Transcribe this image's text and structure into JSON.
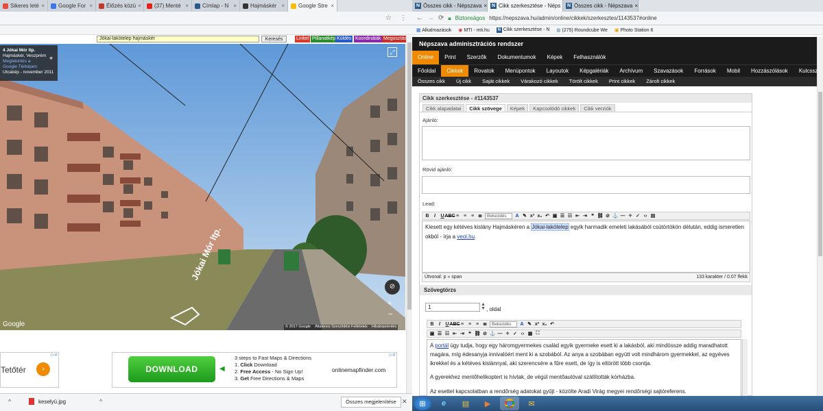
{
  "left": {
    "tabs": [
      {
        "label": "Sikeres leté",
        "color": "#e84b3c"
      },
      {
        "label": "Google For",
        "color": "#3b78e7"
      },
      {
        "label": "Élőzés közü",
        "color": "#c0392b"
      },
      {
        "label": "(37) Menté",
        "color": "#e62117"
      },
      {
        "label": "Címlap - N",
        "color": "#2a5a8a"
      },
      {
        "label": "Hajmáskér",
        "color": "#333333"
      },
      {
        "label": "Google Stre",
        "color": "#fbbc05"
      }
    ],
    "map": {
      "search_value": "Jókai-lakótelep hajmáskér",
      "search_button": "Keresés",
      "buttons": [
        {
          "label": "Linkel",
          "color": "#d83a2c"
        },
        {
          "label": "Pillanatkép",
          "color": "#2e8b2e"
        },
        {
          "label": "Küldés",
          "color": "#2a5ac8"
        },
        {
          "label": "Koordináták",
          "color": "#8a2aa8"
        },
        {
          "label": "Megosztás",
          "color": "#c8302a"
        }
      ],
      "info_title": "4 Jókai Mór ltp.",
      "info_place": "Hajmáskér, Veszprém",
      "info_link1": "Megtekintés a",
      "info_link2": "Google Térképen",
      "info_date": "Utcakép - november 2011",
      "street_label": "Jókai Mór ltp.",
      "google_logo": "Google",
      "footer_copyright": "© 2017 Google",
      "footer_terms": "Általános Szerződési Feltételek",
      "footer_report": "Hibabejelentés"
    },
    "ad_small": {
      "text": "Tetőtér"
    },
    "ad_big": {
      "button": "DOWNLOAD",
      "intro": "3 steps to Fast Maps & Directions",
      "step1_num": "1.",
      "step1_bold": "Click",
      "step1_rest": " Download",
      "step2_num": "2.",
      "step2_bold": "Free Access",
      "step2_rest": " - No Sign Up!",
      "step3_num": "3.",
      "step3_bold": "Get",
      "step3_rest": " Free Directions & Maps",
      "site": "onlinemapfinder.com"
    },
    "downloads": {
      "file": "keselyü.jpg",
      "show_all": "Összes megjelenítése"
    }
  },
  "right": {
    "tabs": [
      {
        "label": "Összes cikk - Népszava"
      },
      {
        "label": "Cikk szerkesztése - Néps"
      },
      {
        "label": "Összes cikk - Népszava"
      }
    ],
    "secure_label": "Biztonságos",
    "url": "https://nepszava.hu/admin/online/cikkek/szerkesztes/1143537#online",
    "bookmarks": [
      {
        "label": "Alkalmazások"
      },
      {
        "label": "MTI - mti.hu"
      },
      {
        "label": "Cikk szerkesztése - N"
      },
      {
        "label": "(275) Roundcube We"
      },
      {
        "label": "Photo Station 6"
      }
    ],
    "header": "Népszava adminisztrációs rendszer",
    "nav1": [
      "Online",
      "Print",
      "Szerzők",
      "Dokumentumok",
      "Képek",
      "Felhasználók"
    ],
    "nav2": [
      "Főoldal",
      "Cikkek",
      "Rovatok",
      "Menüpontok",
      "Layoutok",
      "Képgalériák",
      "Archívum",
      "Szavazások",
      "Források",
      "Mobil",
      "Hozzászólások",
      "Kulcsszavak"
    ],
    "nav3": [
      "Összes cikk",
      "Új cikk",
      "Saját cikkek",
      "Várakozó cikkek",
      "Törölt cikkek",
      "Print cikkek",
      "Zárolt cikkek"
    ],
    "panel_title": "Cikk szerkesztése - #1143537",
    "panel_tabs": [
      "Cikk alapadatai",
      "Cikk szövege",
      "Képek",
      "Kapcsolódó cikkek",
      "Cikk verziók"
    ],
    "labels": {
      "ajanlo": "Ajánló:",
      "rovid": "Rövid ajánló:",
      "lead": "Lead:",
      "szovegtorzs": "Szövegtörzs"
    },
    "lead_text_a": "Kiesett egy kétéves kislány Hajmáskéren a ",
    "lead_highlight": "Jókai-lakótelep",
    "lead_text_b": " egyik harmadik emeleti lakásából csütörtökön délután, eddig ismeretlen okból - írja a ",
    "lead_link": "veol.hu",
    "lead_end": ".",
    "path_label": "Útvonal: p » span",
    "char_count": "133 karakter / 0.07 flekk",
    "format_select": "Bekezdés",
    "page_value": "1",
    "page_suffix": ", oldal",
    "body_p1_link": "portál",
    "body_p1_pre": "A ",
    "body_p1": " úgy tudja, hogy egy háromgyermekes család egyik gyermeke esett ki a lakásból, aki mindössze addig maradhatott magára, míg édesanyja innivalóért ment ki a szobából. Az anya a szobában együtt volt mindhárom gyermekkel, az egyéves ikrekkel és a kétéves kislánnyal, aki szerencsére a fűre esett, de így is eltörött több csontja.",
    "body_p2": "A gyerekhez mentőhelikoptert is hívtak, de végül mentőautóval szállították kórházba.",
    "body_p3": "Az esettel kapcsolatban a rendőrség adatokat gyűjt - közölte Aradi Virág megyei rendőrségi sajtóreferens."
  },
  "taskbar": {
    "icons": [
      "windows-start",
      "internet-explorer",
      "file-explorer",
      "media-player",
      "chrome",
      "folder"
    ]
  }
}
